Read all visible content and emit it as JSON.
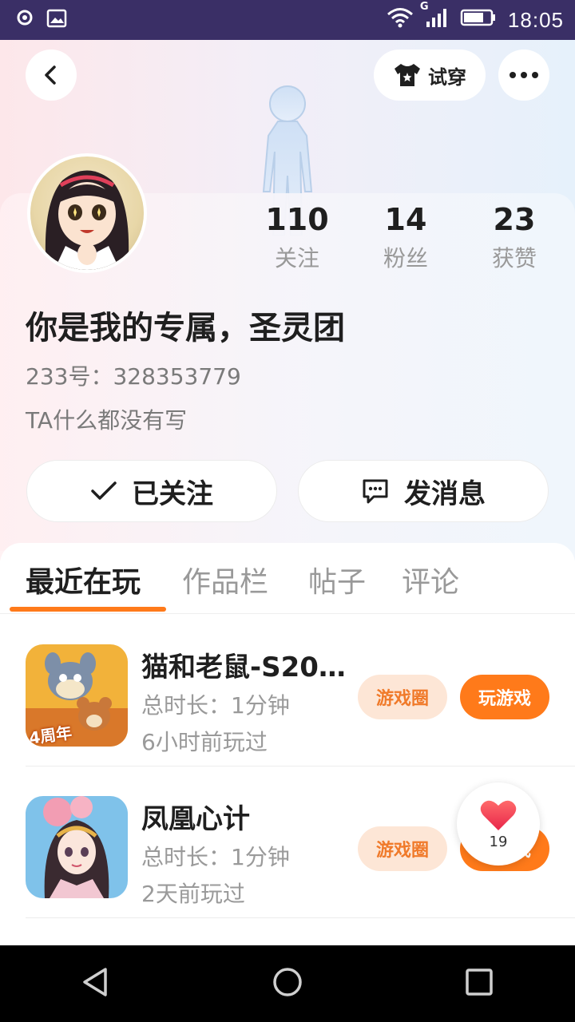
{
  "status_bar": {
    "time": "18:05",
    "network_label": "G"
  },
  "header": {
    "tryon_label": "试穿"
  },
  "profile": {
    "nickname": "你是我的专属，圣灵团",
    "uid": "233号：328353779",
    "bio": "TA什么都没有写",
    "stats": [
      {
        "value": "110",
        "label": "关注"
      },
      {
        "value": "14",
        "label": "粉丝"
      },
      {
        "value": "23",
        "label": "获赞"
      }
    ]
  },
  "actions": {
    "follow_label": "已关注",
    "message_label": "发消息"
  },
  "tabs": [
    "最近在玩",
    "作品栏",
    "帖子",
    "评论"
  ],
  "games": [
    {
      "title": "猫和老鼠-S20…",
      "duration": "总时长：1分钟",
      "last_played": "6小时前玩过",
      "circle_label": "游戏圈",
      "play_label": "玩游戏",
      "icon_badge": "4周年"
    },
    {
      "title": "凤凰心计",
      "duration": "总时长：1分钟",
      "last_played": "2天前玩过",
      "circle_label": "游戏圈",
      "play_label": "玩游戏"
    }
  ],
  "like_float": {
    "count": "19"
  },
  "colors": {
    "accent": "#ff7a1a",
    "status_bar": "#3a2f66"
  }
}
